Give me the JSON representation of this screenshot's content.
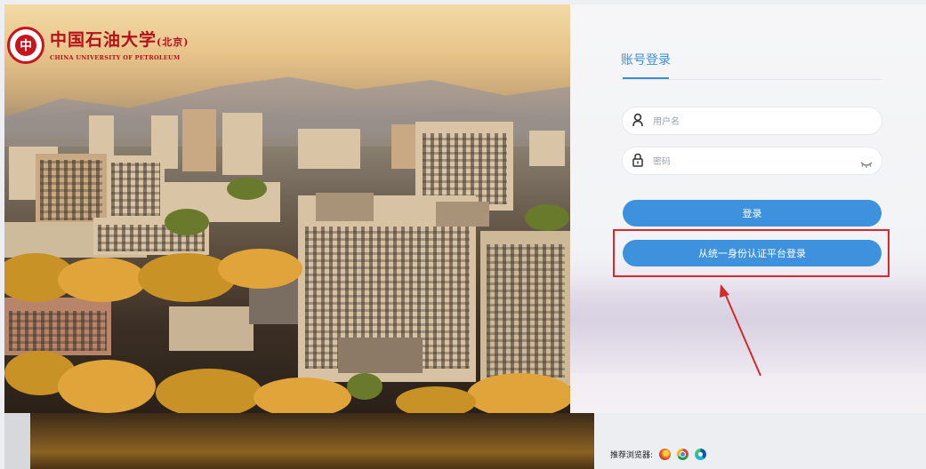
{
  "logo": {
    "seal_char": "中",
    "name_cn": "中国石油大学",
    "name_sub": "(北京)",
    "name_en": "CHINA UNIVERSITY OF PETROLEUM"
  },
  "login": {
    "tab_label": "账号登录",
    "username_placeholder": "用户名",
    "password_placeholder": "密码",
    "login_button": "登录",
    "sso_button": "从统一身份认证平台登录"
  },
  "footer": {
    "browsers_label": "推荐浏览器:",
    "browsers": [
      "firefox-icon",
      "chrome-icon",
      "edge-icon"
    ]
  },
  "colors": {
    "accent": "#3e91dd",
    "highlight": "#e0252b",
    "brand": "#b3121a"
  }
}
